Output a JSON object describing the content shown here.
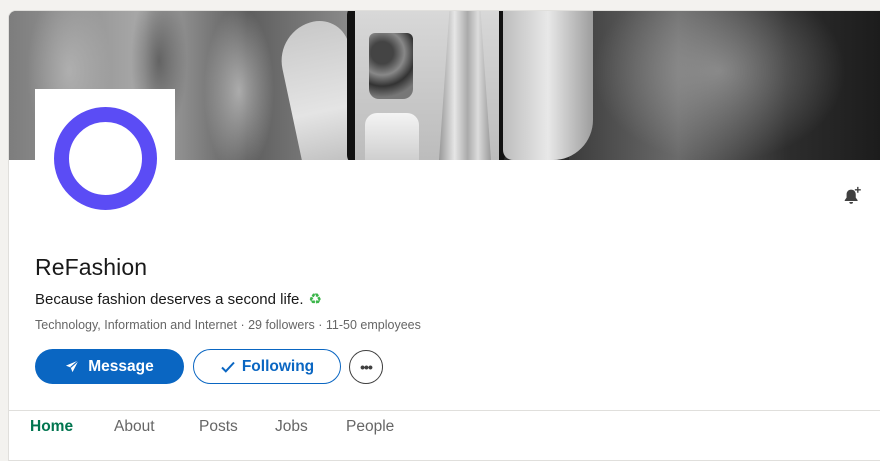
{
  "company": {
    "name": "ReFashion",
    "tagline": "Because fashion deserves a second life.",
    "tagline_emoji": "♻",
    "industry": "Technology, Information and Internet",
    "followers": "29 followers",
    "employees": "11-50 employees",
    "meta_separator": " · ",
    "logo_color": "#5b4cf5"
  },
  "actions": {
    "message_label": "Message",
    "message_icon": "send-icon",
    "following_label": "Following",
    "following_icon": "check-icon",
    "more_label": "•••",
    "notification_icon": "bell-plus-icon"
  },
  "tabs": [
    {
      "label": "Home",
      "active": true
    },
    {
      "label": "About",
      "active": false
    },
    {
      "label": "Posts",
      "active": false
    },
    {
      "label": "Jobs",
      "active": false
    },
    {
      "label": "People",
      "active": false
    }
  ],
  "colors": {
    "primary": "#0a66c2",
    "active_tab": "#01754f",
    "muted_text": "#666666"
  }
}
